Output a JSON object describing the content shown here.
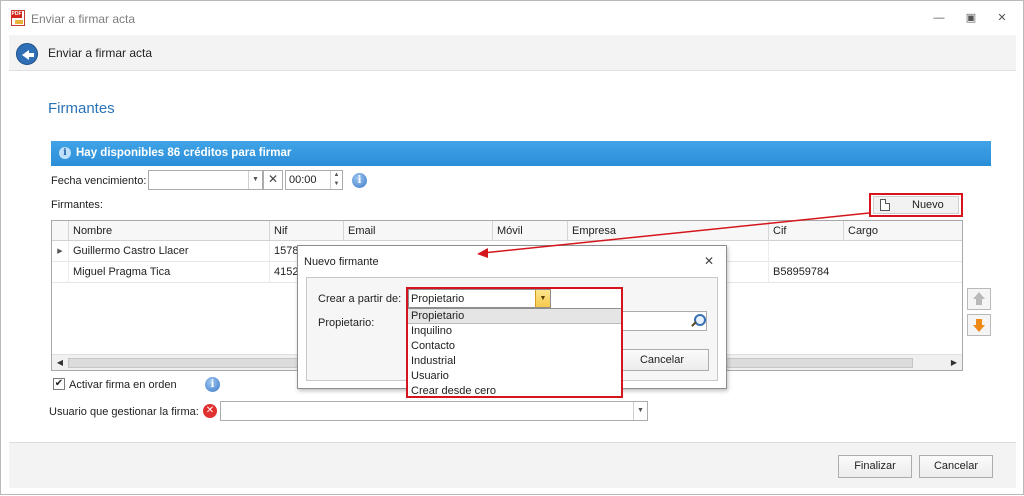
{
  "window": {
    "title": "Enviar a firmar acta",
    "app_icon_text": "PDF",
    "minimize_glyph": "—",
    "maximize_glyph": "▣",
    "close_glyph": "✕"
  },
  "header": {
    "title": "Enviar a firmar acta"
  },
  "section": {
    "title": "Firmantes"
  },
  "banner": {
    "text": "Hay disponibles 86 créditos para firmar"
  },
  "form": {
    "fecha_label": "Fecha vencimiento:",
    "fecha_value": "",
    "time_value": "00:00",
    "firmantes_label": "Firmantes:",
    "activar_label": "Activar firma en orden",
    "activar_checked": true,
    "usuario_label": "Usuario que gestionar la firma:",
    "usuario_value": ""
  },
  "toolbar": {
    "nuevo_label": "Nuevo"
  },
  "table": {
    "columns": [
      "Nombre",
      "Nif",
      "Email",
      "Móvil",
      "Empresa",
      "Cif",
      "Cargo"
    ],
    "rows": [
      {
        "nombre": "Guillermo Castro Llacer",
        "nif": "15780",
        "cif": ""
      },
      {
        "nombre": "Miguel Pragma Tica",
        "nif": "41520",
        "cif": "B58959784"
      }
    ]
  },
  "popup": {
    "title": "Nuevo firmante",
    "crear_label": "Crear a partir de:",
    "crear_value": "Propietario",
    "propietario_label": "Propietario:",
    "cancel_label": "Cancelar",
    "options": [
      "Propietario",
      "Inquilino",
      "Contacto",
      "Industrial",
      "Usuario",
      "Crear desde cero"
    ]
  },
  "footer": {
    "finalizar_label": "Finalizar",
    "cancelar_label": "Cancelar"
  },
  "colors": {
    "accent": "#2a73b9",
    "banner": "#3499e0",
    "highlight": "#d4161c"
  }
}
